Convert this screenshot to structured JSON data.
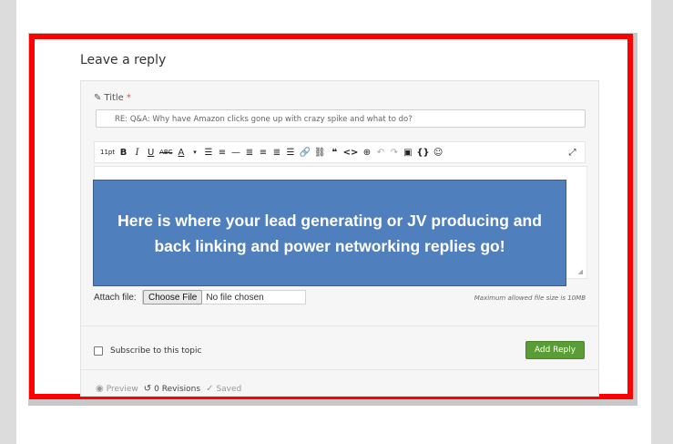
{
  "reply": {
    "heading": "Leave a reply",
    "title_label": "Title",
    "title_required": "*",
    "title_value": "RE: Q&A: Why have Amazon clicks gone up with crazy spike and what to do?",
    "toolbar": {
      "font_size": "11pt",
      "items": [
        "bold-icon",
        "italic-icon",
        "underline-icon",
        "strikethrough-icon",
        "text-color-icon",
        "bullet-list-icon",
        "numbered-list-icon",
        "horizontal-rule-icon",
        "align-left-icon",
        "align-center-icon",
        "align-right-icon",
        "justify-icon",
        "link-icon",
        "unlink-icon",
        "quote-icon",
        "code-icon",
        "insert-icon",
        "undo-icon",
        "redo-icon",
        "paste-icon",
        "template-icon",
        "emoji-icon",
        "expand-icon"
      ]
    },
    "callout_text": "Here is where your lead generating or JV producing and back linking and power networking replies go!",
    "attach_label": "Attach file:",
    "choose_file": "Choose File",
    "no_file": "No file chosen",
    "max_size": "Maximum allowed file size is 10MB",
    "subscribe_label": "Subscribe to this topic",
    "add_reply": "Add Reply",
    "preview": "Preview",
    "revisions": "0 Revisions",
    "saved": "Saved"
  },
  "colors": {
    "frame": "#ff0000",
    "callout": "#4f7fbc",
    "add_reply": "#5a9c35"
  }
}
